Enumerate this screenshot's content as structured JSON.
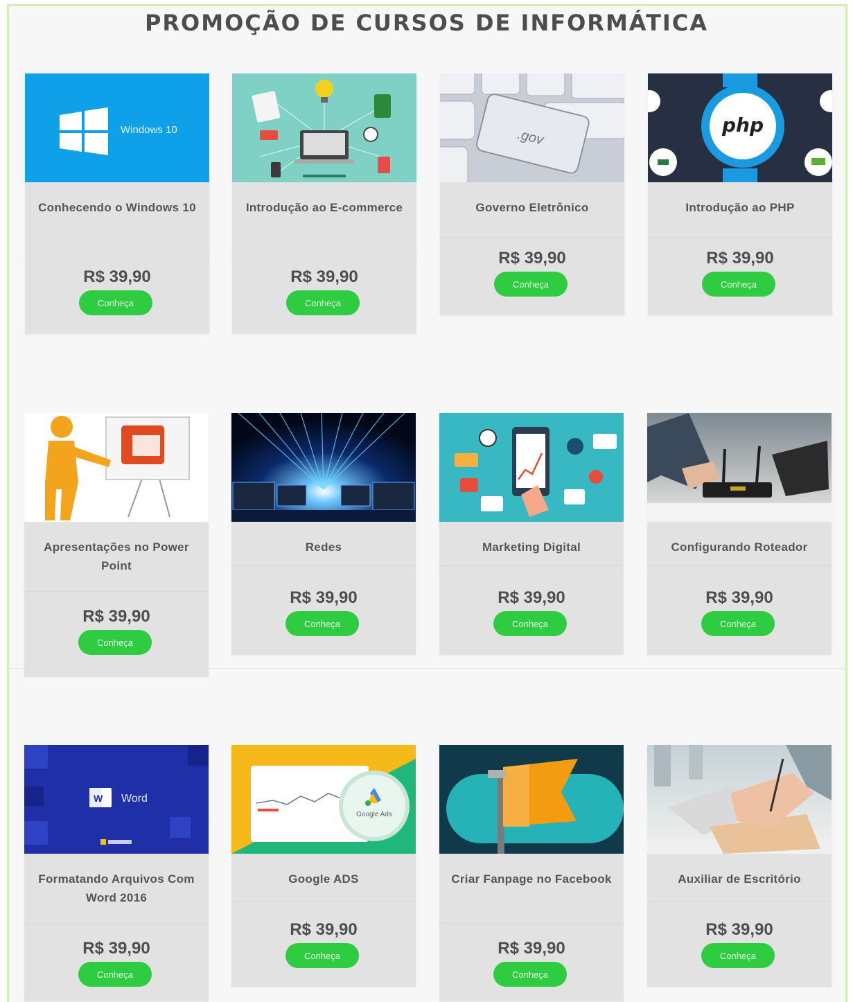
{
  "page": {
    "title": "PROMOÇÃO DE CURSOS DE INFORMÁTICA"
  },
  "colors": {
    "button": "#2ecc40",
    "card": "#e2e2e2",
    "background": "#f7f7f7",
    "frame_border": "#d4ecb8"
  },
  "courses": [
    {
      "name": "Conhecendo o Windows 10",
      "price": "R$ 39,90",
      "button_label": "Conheça",
      "image": "windows-10-logo",
      "image_text": "Windows 10"
    },
    {
      "name": "Introdução ao E-commerce",
      "price": "R$ 39,90",
      "button_label": "Conheça",
      "image": "ecommerce-illustration"
    },
    {
      "name": "Governo Eletrônico",
      "price": "R$ 39,90",
      "button_label": "Conheça",
      "image": "keyboard-gov-key",
      "image_text": ".gov"
    },
    {
      "name": "Introdução ao PHP",
      "price": "R$ 39,90",
      "button_label": "Conheça",
      "image": "php-logo",
      "image_text": "php"
    },
    {
      "name": "Apresentações no Power Point",
      "price": "R$ 39,90",
      "button_label": "Conheça",
      "image": "powerpoint-presenter"
    },
    {
      "name": "Redes",
      "price": "R$ 39,90",
      "button_label": "Conheça",
      "image": "network-data-tunnel"
    },
    {
      "name": "Marketing Digital",
      "price": "R$ 39,90",
      "button_label": "Conheça",
      "image": "digital-marketing-illustration"
    },
    {
      "name": "Configurando Roteador",
      "price": "R$ 39,90",
      "button_label": "Conheça",
      "image": "router-photo"
    },
    {
      "name": "Formatando Arquivos Com Word 2016",
      "price": "R$ 39,90",
      "button_label": "Conheça",
      "image": "word-logo",
      "image_text": "Word"
    },
    {
      "name": "Google ADS",
      "price": "R$ 39,90",
      "button_label": "Conheça",
      "image": "google-ads-logo",
      "image_text": "Google Ads"
    },
    {
      "name": "Criar Fanpage no Facebook",
      "price": "R$ 39,90",
      "button_label": "Conheça",
      "image": "fanpage-flag"
    },
    {
      "name": "Auxiliar de Escritório",
      "price": "R$ 39,90",
      "button_label": "Conheça",
      "image": "office-writing-photo"
    }
  ]
}
